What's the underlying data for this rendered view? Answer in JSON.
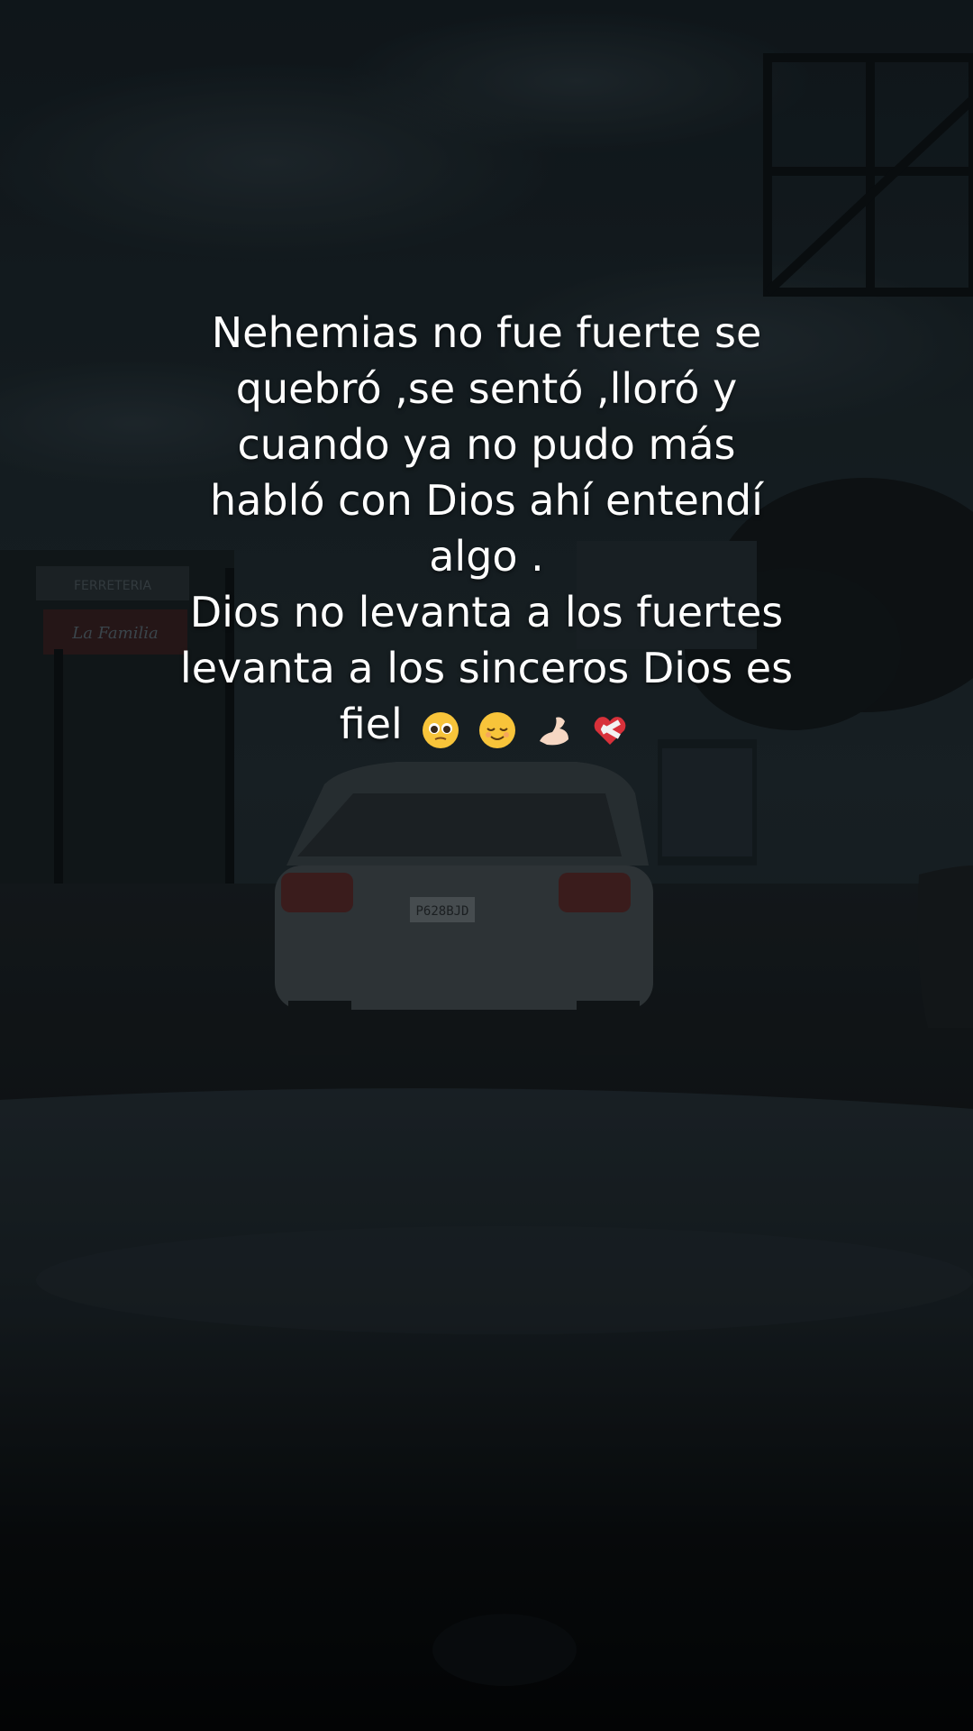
{
  "caption": {
    "lines": [
      "Nehemias no fue fuerte se",
      "quebró ,se sentó ,lloró y",
      "cuando ya no pudo más",
      "habló con Dios ahí entendí",
      "algo .",
      "Dios no levanta a los fuertes",
      "levanta a los sinceros Dios es",
      "fiel"
    ],
    "emojis": [
      "pleading-face",
      "relieved-face",
      "flexed-biceps",
      "mending-heart"
    ]
  },
  "scene": {
    "shop_sign": "FERRETERIA",
    "shop_sign_sub": "La Familia",
    "plate": "P628BJD",
    "colors": {
      "sky": "#1e2a30",
      "road": "#1a2024",
      "car": "#3e474c",
      "taillight": "#7a2a2a",
      "text": "#ffffff"
    }
  }
}
